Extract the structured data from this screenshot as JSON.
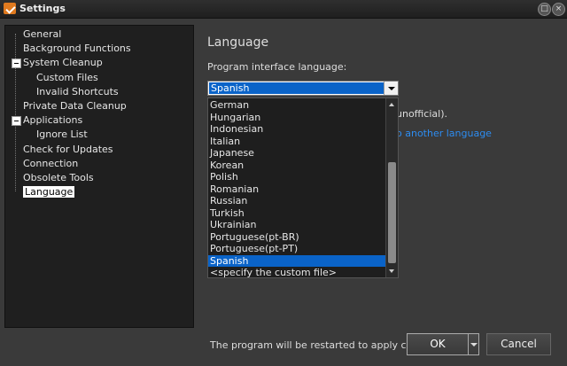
{
  "window": {
    "title": "Settings",
    "icon": "app-check-icon",
    "maximize_icon": "□",
    "close_icon": "×"
  },
  "tree": {
    "items": [
      {
        "label": "General",
        "indent": 0,
        "expander": false,
        "selected": false
      },
      {
        "label": "Background Functions",
        "indent": 0,
        "expander": false,
        "selected": false
      },
      {
        "label": "System Cleanup",
        "indent": 0,
        "expander": true,
        "selected": false
      },
      {
        "label": "Custom Files",
        "indent": 1,
        "expander": false,
        "selected": false
      },
      {
        "label": "Invalid Shortcuts",
        "indent": 1,
        "expander": false,
        "selected": false
      },
      {
        "label": "Private Data Cleanup",
        "indent": 0,
        "expander": false,
        "selected": false
      },
      {
        "label": "Applications",
        "indent": 0,
        "expander": true,
        "selected": false
      },
      {
        "label": "Ignore List",
        "indent": 1,
        "expander": false,
        "selected": false
      },
      {
        "label": "Check for Updates",
        "indent": 0,
        "expander": false,
        "selected": false
      },
      {
        "label": "Connection",
        "indent": 0,
        "expander": false,
        "selected": false
      },
      {
        "label": "Obsolete Tools",
        "indent": 0,
        "expander": false,
        "selected": false
      },
      {
        "label": "Language",
        "indent": 0,
        "expander": false,
        "selected": true
      }
    ]
  },
  "panel": {
    "title": "Language",
    "field_label": "Program interface language:",
    "selected_value": "Spanish",
    "partial_note": "unofficial).",
    "partial_link": "o another language",
    "dropdown_options": [
      "German",
      "Hungarian",
      "Indonesian",
      "Italian",
      "Japanese",
      "Korean",
      "Polish",
      "Romanian",
      "Russian",
      "Turkish",
      "Ukrainian",
      "Portuguese(pt-BR)",
      "Portuguese(pt-PT)",
      "Spanish",
      "<specify the custom file>"
    ],
    "selected_option_index": 13
  },
  "footer": {
    "restart_note": "The program will be restarted to apply chan...",
    "ok_label": "OK",
    "cancel_label": "Cancel"
  },
  "colors": {
    "selection": "#0a63c8",
    "link": "#2d8cf0"
  }
}
